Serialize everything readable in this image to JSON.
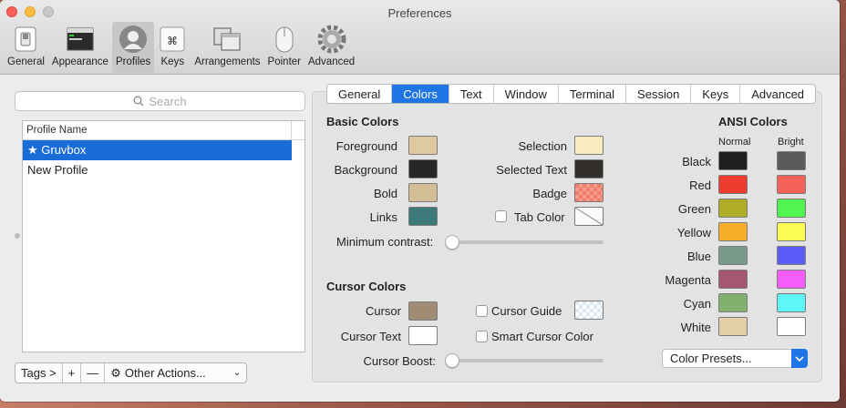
{
  "window": {
    "title": "Preferences"
  },
  "toolbar": {
    "items": [
      {
        "label": "General",
        "icon": "switch-icon"
      },
      {
        "label": "Appearance",
        "icon": "window-icon"
      },
      {
        "label": "Profiles",
        "icon": "profile-icon"
      },
      {
        "label": "Keys",
        "icon": "keyboard-icon"
      },
      {
        "label": "Arrangements",
        "icon": "arrangements-icon"
      },
      {
        "label": "Pointer",
        "icon": "mouse-icon"
      },
      {
        "label": "Advanced",
        "icon": "gear-icon"
      }
    ],
    "selected": "Profiles"
  },
  "sidebar": {
    "search_placeholder": "Search",
    "column_header": "Profile Name",
    "profiles": [
      "★ Gruvbox",
      "New Profile"
    ],
    "selected_index": 0,
    "tags_label": "Tags >",
    "add_label": "+",
    "remove_label": "—",
    "other_actions_label": "Other Actions..."
  },
  "tabs": {
    "items": [
      "General",
      "Colors",
      "Text",
      "Window",
      "Terminal",
      "Session",
      "Keys",
      "Advanced"
    ],
    "selected": "Colors"
  },
  "basic_colors": {
    "heading": "Basic Colors",
    "foreground_label": "Foreground",
    "foreground": "#dfc9a0",
    "background_label": "Background",
    "background": "#272727",
    "bold_label": "Bold",
    "bold": "#d4be98",
    "links_label": "Links",
    "links": "#3f7a7a",
    "selection_label": "Selection",
    "selection": "#f9ecc1",
    "selected_text_label": "Selected Text",
    "selected_text": "#332f2b",
    "badge_label": "Badge",
    "badge": "#f07a68",
    "tab_color_label": "Tab Color",
    "min_contrast_label": "Minimum contrast:",
    "min_contrast_value": 0
  },
  "cursor_colors": {
    "heading": "Cursor Colors",
    "cursor_label": "Cursor",
    "cursor": "#a08b74",
    "cursor_text_label": "Cursor Text",
    "cursor_text": "#ffffff",
    "cursor_guide_label": "Cursor Guide",
    "smart_cursor_label": "Smart Cursor Color",
    "cursor_boost_label": "Cursor Boost:",
    "cursor_boost_value": 0
  },
  "ansi_colors": {
    "heading": "ANSI Colors",
    "normal_label": "Normal",
    "bright_label": "Bright",
    "rows": [
      {
        "name": "Black",
        "normal": "#1e1e1e",
        "bright": "#5b5b5b"
      },
      {
        "name": "Red",
        "normal": "#ee3c2e",
        "bright": "#f4625a"
      },
      {
        "name": "Green",
        "normal": "#afad25",
        "bright": "#50f550"
      },
      {
        "name": "Yellow",
        "normal": "#f6af2b",
        "bright": "#fbfb52"
      },
      {
        "name": "Blue",
        "normal": "#7a9a8c",
        "bright": "#5a5df8"
      },
      {
        "name": "Magenta",
        "normal": "#a55670",
        "bright": "#f55cf8"
      },
      {
        "name": "Cyan",
        "normal": "#82b06e",
        "bright": "#5ef6f9"
      },
      {
        "name": "White",
        "normal": "#e3d0a6",
        "bright": "#ffffff"
      }
    ],
    "presets_label": "Color Presets..."
  }
}
